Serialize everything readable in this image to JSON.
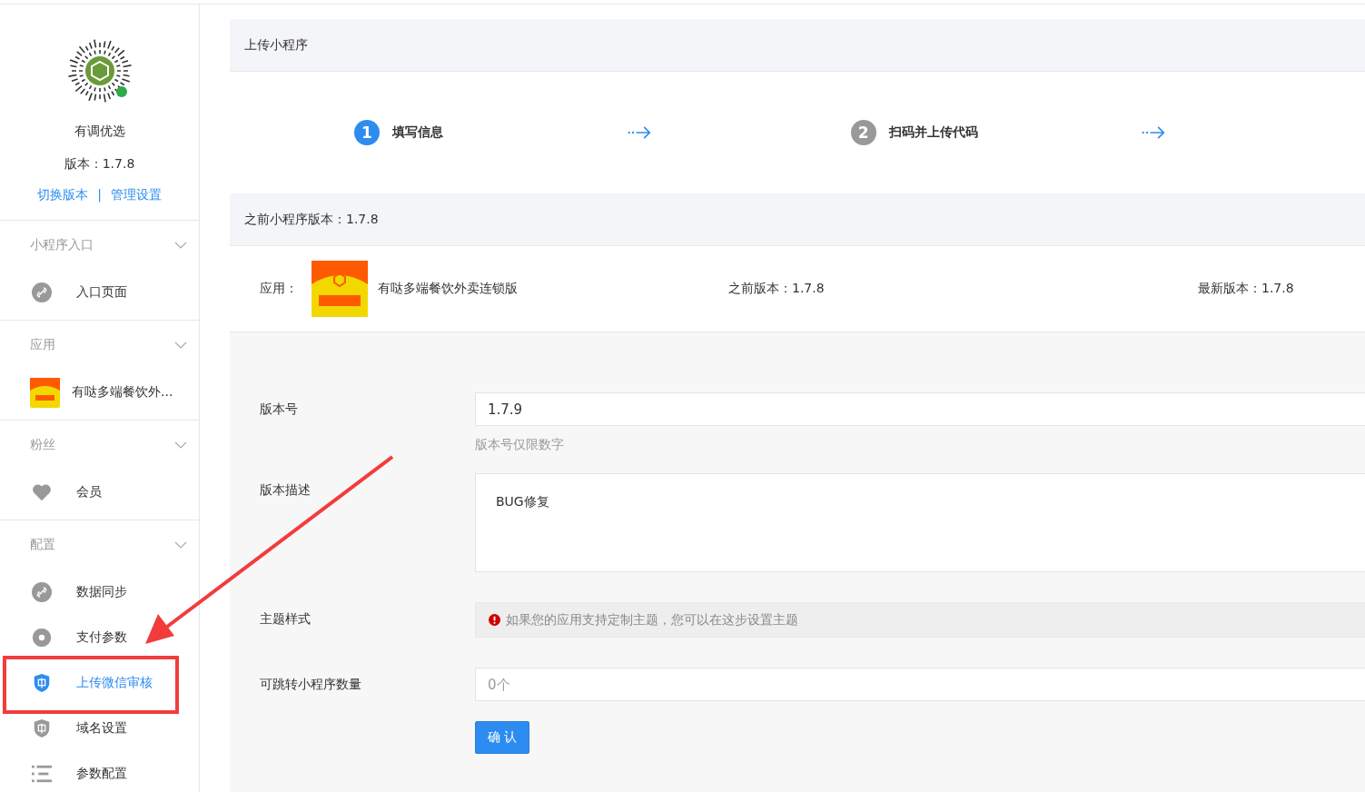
{
  "sidebar": {
    "app_name": "有调优选",
    "version": "版本：1.7.8",
    "links": [
      "切换版本",
      "管理设置"
    ],
    "separator": "|",
    "groups": [
      {
        "title": "小程序入口",
        "items": [
          {
            "label": "入口页面",
            "kind": "link",
            "selected": false
          }
        ]
      },
      {
        "title": "应用",
        "items": [
          {
            "label": "有哒多端餐饮外...",
            "kind": "app",
            "selected": false
          }
        ]
      },
      {
        "title": "粉丝",
        "items": [
          {
            "label": "会员",
            "kind": "heart",
            "selected": false
          }
        ]
      },
      {
        "title": "配置",
        "items": [
          {
            "label": "数据同步",
            "kind": "link",
            "selected": false
          },
          {
            "label": "支付参数",
            "kind": "gear",
            "selected": false
          },
          {
            "label": "上传微信审核",
            "kind": "shield",
            "selected": true
          },
          {
            "label": "域名设置",
            "kind": "shield",
            "selected": false
          },
          {
            "label": "参数配置",
            "kind": "list",
            "selected": false
          }
        ]
      }
    ]
  },
  "page_title": "上传小程序",
  "steps": [
    {
      "number": "1",
      "label": "填写信息",
      "selected": true
    },
    {
      "number": "2",
      "label": "扫码并上传代码",
      "selected": false
    }
  ],
  "previous_version_title": "之前小程序版本：1.7.8",
  "app_row": {
    "label": "应用：",
    "name": "有哒多端餐饮外卖连锁版",
    "previous": "之前版本：1.7.8",
    "latest": "最新版本：1.7.8"
  },
  "form": {
    "fields": [
      {
        "kind": "input",
        "label": "版本号",
        "value": "1.7.9",
        "hint": "版本号仅限数字"
      },
      {
        "kind": "textarea",
        "label": "版本描述",
        "value": "BUG修复"
      },
      {
        "kind": "notice",
        "label": "主题样式",
        "text": "如果您的应用支持定制主题，您可以在这步设置主题"
      },
      {
        "kind": "input",
        "label": "可跳转小程序数量",
        "placeholder": "0个"
      }
    ],
    "submit": "确 认"
  }
}
